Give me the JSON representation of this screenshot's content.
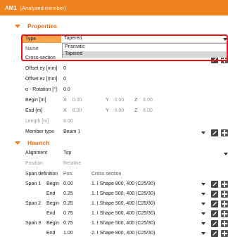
{
  "titlebar": {
    "id": "AM1",
    "subtitle": "[Analyzed member]"
  },
  "properties": {
    "heading": "Properties",
    "type_label": "Type",
    "type_value": "Tapered",
    "type_options": [
      "Prismatic",
      "Tapered"
    ],
    "name_label": "Name",
    "cross_section_label": "Cross-section",
    "offset_ey_label": "Offset ey [mm]",
    "offset_ey_value": "0",
    "offset_ez_label": "Offset ez [mm]",
    "offset_ez_value": "0",
    "rotation_label": "α - Rotation [°]",
    "rotation_value": "0.0",
    "begin_label": "Begin [m]",
    "begin": {
      "x_axis": "X",
      "x": "0.00",
      "y_axis": "Y",
      "y": "0.00",
      "z_axis": "Z",
      "z": "6.00"
    },
    "end_label": "End [m]",
    "end": {
      "x_axis": "X",
      "x": "8.00",
      "y_axis": "Y",
      "y": "0.00",
      "z_axis": "Z",
      "z": "6.00"
    },
    "length_label": "Length [m]",
    "length_value": "8.00",
    "member_type_label": "Member type",
    "member_type_value": "Beam 1"
  },
  "haunch": {
    "heading": "Haunch",
    "alignment_label": "Alignment",
    "alignment_value": "Top",
    "position_label": "Position",
    "position_value": "Relative",
    "span_def_label": "Span definition",
    "col_pos": "Pos.",
    "col_cs": "Cross section",
    "spans": [
      {
        "name": "Span 1",
        "end": "Begin",
        "pos": "0.00",
        "cs": "1. I Shape 800, 400 (C25/30)"
      },
      {
        "name": "",
        "end": "End",
        "pos": "0.25",
        "cs": "1. I Shape 500, 400 (C25/30)"
      },
      {
        "name": "Span 2",
        "end": "Begin",
        "pos": "0.25",
        "cs": "1. I Shape 500, 400 (C25/30)"
      },
      {
        "name": "",
        "end": "End",
        "pos": "0.75",
        "cs": "1. I Shape 500, 400 (C25/30)"
      },
      {
        "name": "Span 3",
        "end": "Begin",
        "pos": "0.75",
        "cs": "1. I Shape 500, 400 (C25/30)"
      },
      {
        "name": "",
        "end": "End",
        "pos": "1.00",
        "cs": "2. I Shape 800, 400 (C25/30)"
      }
    ]
  },
  "colors": {
    "accent": "#f0821e",
    "highlight_border": "#e3141b",
    "selected_row": "#f7a34a"
  }
}
